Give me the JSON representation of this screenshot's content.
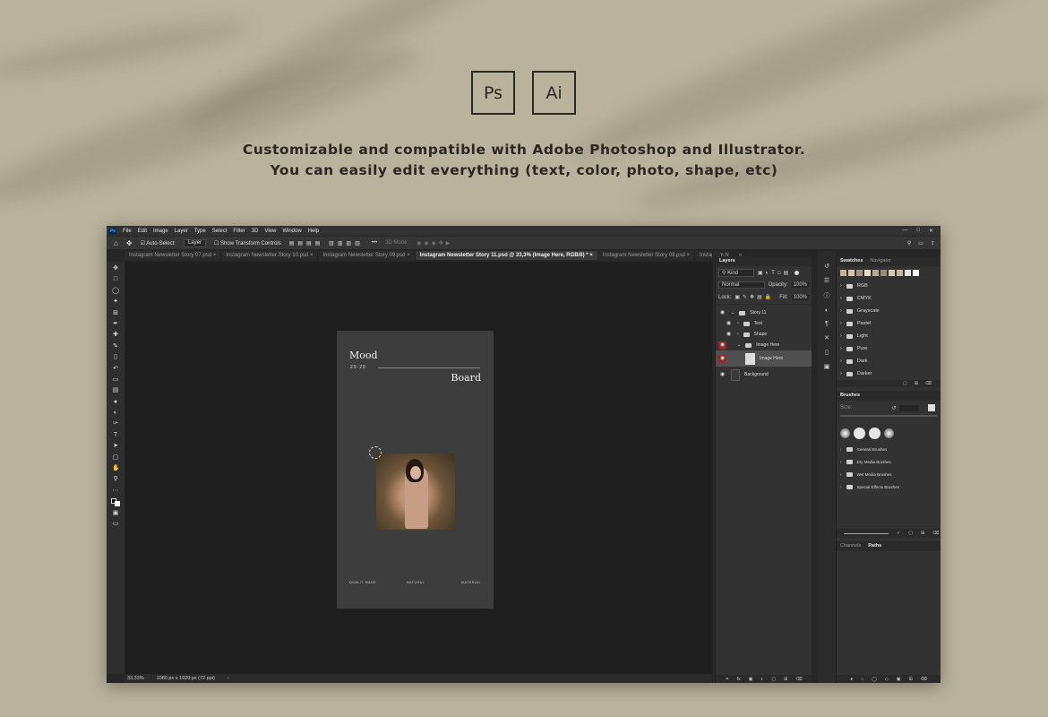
{
  "badges": [
    {
      "label": "Ps"
    },
    {
      "label": "Ai"
    }
  ],
  "headline": {
    "line1": "Customizable and compatible with Adobe Photoshop and Illustrator.",
    "line2": "You can easily edit everything (text, color, photo, shape, etc)"
  },
  "photoshop": {
    "app_icon": "Ps",
    "menu": [
      "File",
      "Edit",
      "Image",
      "Layer",
      "Type",
      "Select",
      "Filter",
      "3D",
      "View",
      "Window",
      "Help"
    ],
    "options": {
      "auto_select": "Auto-Select:",
      "layer_select": "Layer",
      "show_transform": "Show Transform Controls",
      "mode_3d": "3D Mode:"
    },
    "tabs": [
      {
        "label": "Instagram Newsletter Story 07.psd",
        "active": false
      },
      {
        "label": "Instagram Newsletter Story 10.psd",
        "active": false
      },
      {
        "label": "Instagram Newsletter Story 09.psd",
        "active": false
      },
      {
        "label": "Instagram Newsletter Story 11.psd @ 33,3% (Image Here, RGB/8) *",
        "active": true
      },
      {
        "label": "Instagram Newsletter Story 08.psd",
        "active": false
      },
      {
        "label": "Instagram N",
        "active": false
      }
    ],
    "artboard": {
      "title": "Mood",
      "year": "20-20",
      "subtitle": "Board",
      "footer": [
        "QUALIT MADE",
        "NATURAL",
        "MATERIAL"
      ]
    },
    "status": {
      "zoom": "33,33%",
      "size": "1080 px x 1920 px (72 ppi)"
    },
    "layers_panel": {
      "title": "Layers",
      "filter": "Kind",
      "blend": "Normal",
      "opacity_label": "Opacity:",
      "opacity": "100%",
      "lock_label": "Lock:",
      "fill_label": "Fill:",
      "fill": "100%",
      "items": [
        {
          "name": "Story 11",
          "highlight": false,
          "selected": false
        },
        {
          "name": "Text",
          "highlight": false,
          "selected": false
        },
        {
          "name": "Shape",
          "highlight": false,
          "selected": false
        },
        {
          "name": "Image Here",
          "highlight": true,
          "selected": false
        },
        {
          "name": "Image Here",
          "highlight": true,
          "selected": true
        },
        {
          "name": "Background",
          "highlight": false,
          "selected": false
        }
      ]
    },
    "swatches_panel": {
      "tabs": [
        "Swatches",
        "Navigator"
      ],
      "colors": [
        "#c9b29a",
        "#d8c3ad",
        "#a89380",
        "#e8dccd",
        "#b7a898",
        "#9b8b7a",
        "#d5c8b8",
        "#c7b8a7",
        "#ede4d8",
        "#ffffff"
      ],
      "groups": [
        "RGB",
        "CMYK",
        "Grayscale",
        "Pastel",
        "Light",
        "Pure",
        "Dark",
        "Darker"
      ]
    },
    "brushes_panel": {
      "title": "Brushes",
      "size_label": "Size:",
      "groups": [
        "General Brushes",
        "Dry Media Brushes",
        "Wet Media Brushes",
        "Special Effects Brushes"
      ]
    },
    "bottom_panel": {
      "tabs": [
        "Channels",
        "Paths"
      ]
    }
  }
}
